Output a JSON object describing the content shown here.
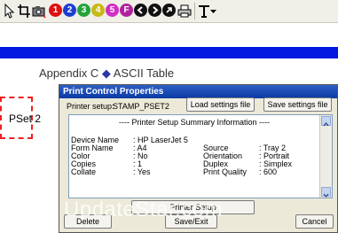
{
  "toolbar": {
    "tools": [
      "pointer-icon",
      "crop-icon",
      "camera-icon",
      "1",
      "2",
      "3",
      "4",
      "5",
      "F",
      "arrow-left-icon",
      "arrow-right-icon",
      "info-icon",
      "print-icon",
      "text-icon",
      "dropdown-icon"
    ],
    "circle_colors": [
      "#dd1111",
      "#1d3fd1",
      "#25a33a",
      "#c8b816",
      "#d02fc4",
      "#b0229d"
    ]
  },
  "banner_color": "#0018e0",
  "heading": {
    "prefix": "Appendix C",
    "diamond": "◆",
    "suffix": "ASCII Table"
  },
  "pset_label": "PSet 2",
  "dialog": {
    "title": "Print Control Properties",
    "printer_setup_label": "Printer setup:",
    "printer_setup_value": "STAMP_PSET2",
    "load_button": "Load settings file",
    "save_button": "Save settings file",
    "summary_title": "---- Printer Setup Summary Information ----",
    "summary_left": [
      {
        "key": "Device Name",
        "value": ": HP LaserJet 5"
      },
      {
        "key": "Form Name",
        "value": ": A4"
      },
      {
        "key": "Color",
        "value": ": No"
      },
      {
        "key": "Copies",
        "value": ": 1"
      },
      {
        "key": "Collate",
        "value": ": Yes"
      }
    ],
    "summary_right": [
      {
        "key": "Source",
        "value": ": Tray 2"
      },
      {
        "key": "Orientation",
        "value": ": Portrait"
      },
      {
        "key": "Duplex",
        "value": ": Simplex"
      },
      {
        "key": "Print Quality",
        "value": ": 600"
      }
    ],
    "printer_setup_button": "Printer Setup",
    "delete_button": "Delete",
    "saveexit_button": "Save/Exit",
    "cancel_button": "Cancel"
  },
  "watermark": "UpdateStar.com"
}
